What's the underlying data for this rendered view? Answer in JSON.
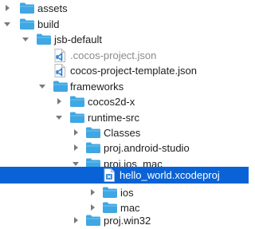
{
  "items": [
    {
      "label": "assets",
      "icon": "folder-icon",
      "toggle": "collapsed",
      "dim": false,
      "selected": false
    },
    {
      "label": "build",
      "icon": "folder-icon",
      "toggle": "expanded",
      "dim": false,
      "selected": false
    },
    {
      "label": "jsb-default",
      "icon": "folder-icon",
      "toggle": "expanded",
      "dim": false,
      "selected": false
    },
    {
      "label": ".cocos-project.json",
      "icon": "vscode-file-icon",
      "toggle": "none",
      "dim": true,
      "selected": false
    },
    {
      "label": "cocos-project-template.json",
      "icon": "vscode-file-icon",
      "toggle": "none",
      "dim": false,
      "selected": false
    },
    {
      "label": "frameworks",
      "icon": "folder-icon",
      "toggle": "expanded",
      "dim": false,
      "selected": false
    },
    {
      "label": "cocos2d-x",
      "icon": "folder-icon",
      "toggle": "collapsed",
      "dim": false,
      "selected": false
    },
    {
      "label": "runtime-src",
      "icon": "folder-icon",
      "toggle": "expanded",
      "dim": false,
      "selected": false
    },
    {
      "label": "Classes",
      "icon": "folder-icon",
      "toggle": "collapsed",
      "dim": false,
      "selected": false
    },
    {
      "label": "proj.android-studio",
      "icon": "folder-icon",
      "toggle": "collapsed",
      "dim": false,
      "selected": false
    },
    {
      "label": "proj.ios_mac",
      "icon": "folder-icon",
      "toggle": "expanded",
      "dim": false,
      "selected": false
    },
    {
      "label": "hello_world.xcodeproj",
      "icon": "xcode-project-icon",
      "toggle": "none",
      "dim": false,
      "selected": true
    },
    {
      "label": "ios",
      "icon": "folder-icon",
      "toggle": "collapsed",
      "dim": false,
      "selected": false
    },
    {
      "label": "mac",
      "icon": "folder-icon",
      "toggle": "collapsed",
      "dim": false,
      "selected": false
    },
    {
      "label": "proj.win32",
      "icon": "folder-icon",
      "toggle": "collapsed",
      "dim": false,
      "selected": false
    }
  ],
  "colors": {
    "folder": "#3fa7e3",
    "folder_tab": "#74c4f0",
    "selection": "#0a63d6",
    "vscode_blue": "#2a7fd0"
  }
}
